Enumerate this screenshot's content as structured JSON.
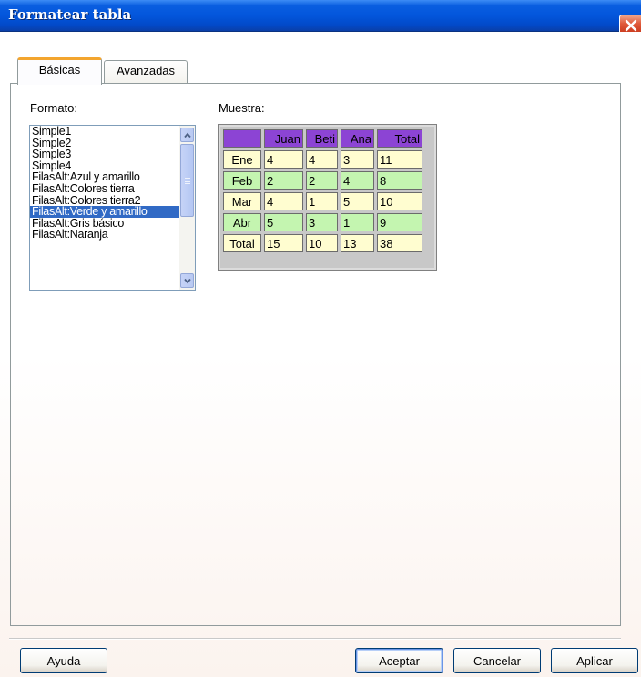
{
  "window": {
    "title": "Formatear tabla"
  },
  "tabs": [
    {
      "label": "Básicas",
      "active": true
    },
    {
      "label": "Avanzadas",
      "active": false
    }
  ],
  "format": {
    "label": "Formato:",
    "items": [
      "Simple1",
      "Simple2",
      "Simple3",
      "Simple4",
      "FilasAlt:Azul y amarillo",
      "FilasAlt:Colores tierra",
      "FilasAlt:Colores tierra2",
      "FilasAlt:Verde y amarillo",
      "FilasAlt:Gris básico",
      "FilasAlt:Naranja"
    ],
    "selected": "FilasAlt:Verde y amarillo"
  },
  "sample": {
    "label": "Muestra:",
    "header": [
      "",
      "Juan",
      "Beti",
      "Ana",
      "Total"
    ],
    "rows": [
      [
        "Ene",
        "4",
        "4",
        "3",
        "11"
      ],
      [
        "Feb",
        "2",
        "2",
        "4",
        "8"
      ],
      [
        "Mar",
        "4",
        "1",
        "5",
        "10"
      ],
      [
        "Abr",
        "5",
        "3",
        "1",
        "9"
      ],
      [
        "Total",
        "15",
        "10",
        "13",
        "38"
      ]
    ],
    "colors": {
      "header": "#8c44d4",
      "row_cream": "#fffdd0",
      "row_green": "#c4f5b0"
    }
  },
  "buttons": {
    "help": "Ayuda",
    "accept": "Aceptar",
    "cancel": "Cancelar",
    "apply": "Aplicar"
  },
  "icons": {
    "close": "close-icon",
    "scroll_up": "chevron-up-icon",
    "scroll_down": "chevron-down-icon"
  }
}
